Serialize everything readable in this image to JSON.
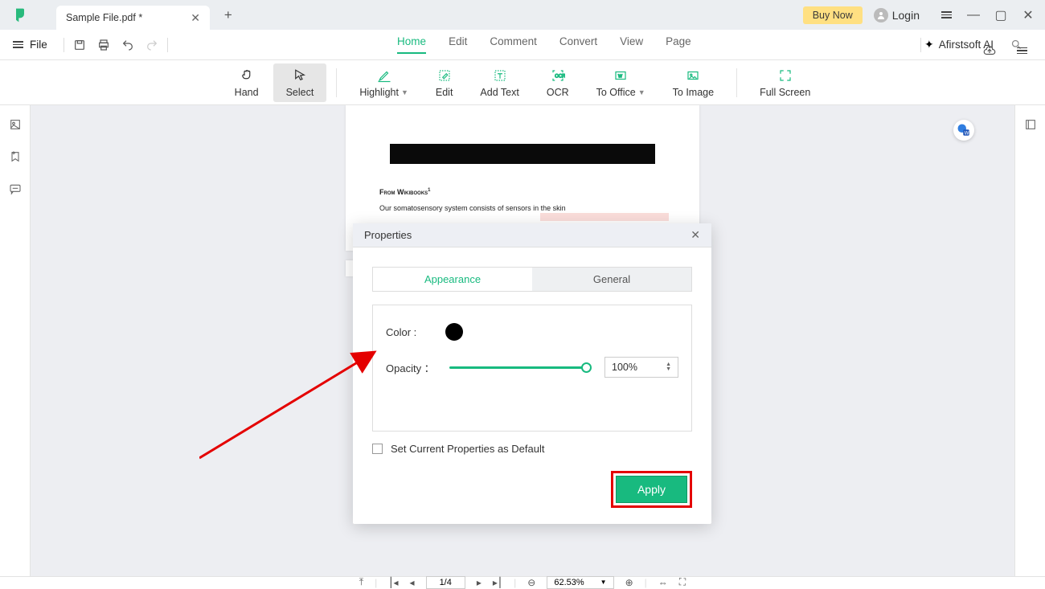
{
  "titlebar": {
    "tab_name": "Sample File.pdf *",
    "buy_now": "Buy Now",
    "login": "Login"
  },
  "menubar": {
    "file": "File",
    "items": [
      "Home",
      "Edit",
      "Comment",
      "Convert",
      "View",
      "Page"
    ],
    "active_index": 0,
    "ai": "Afirstsoft AI"
  },
  "toolbar": {
    "hand": "Hand",
    "select": "Select",
    "highlight": "Highlight",
    "edit": "Edit",
    "add_text": "Add Text",
    "ocr": "OCR",
    "to_office": "To Office",
    "to_image": "To Image",
    "full_screen": "Full Screen"
  },
  "document": {
    "from": "From Wikibooks",
    "line1": "Our somatosensory system consists of sensors in the skin",
    "page_num": "1"
  },
  "dialog": {
    "title": "Properties",
    "tabs": {
      "appearance": "Appearance",
      "general": "General"
    },
    "color_label": "Color :",
    "color_value": "#000000",
    "opacity_label": "Opacity ：",
    "opacity_value": "100%",
    "set_default": "Set Current Properties as Default",
    "apply": "Apply"
  },
  "bottombar": {
    "page": "1/4",
    "zoom": "62.53%"
  }
}
